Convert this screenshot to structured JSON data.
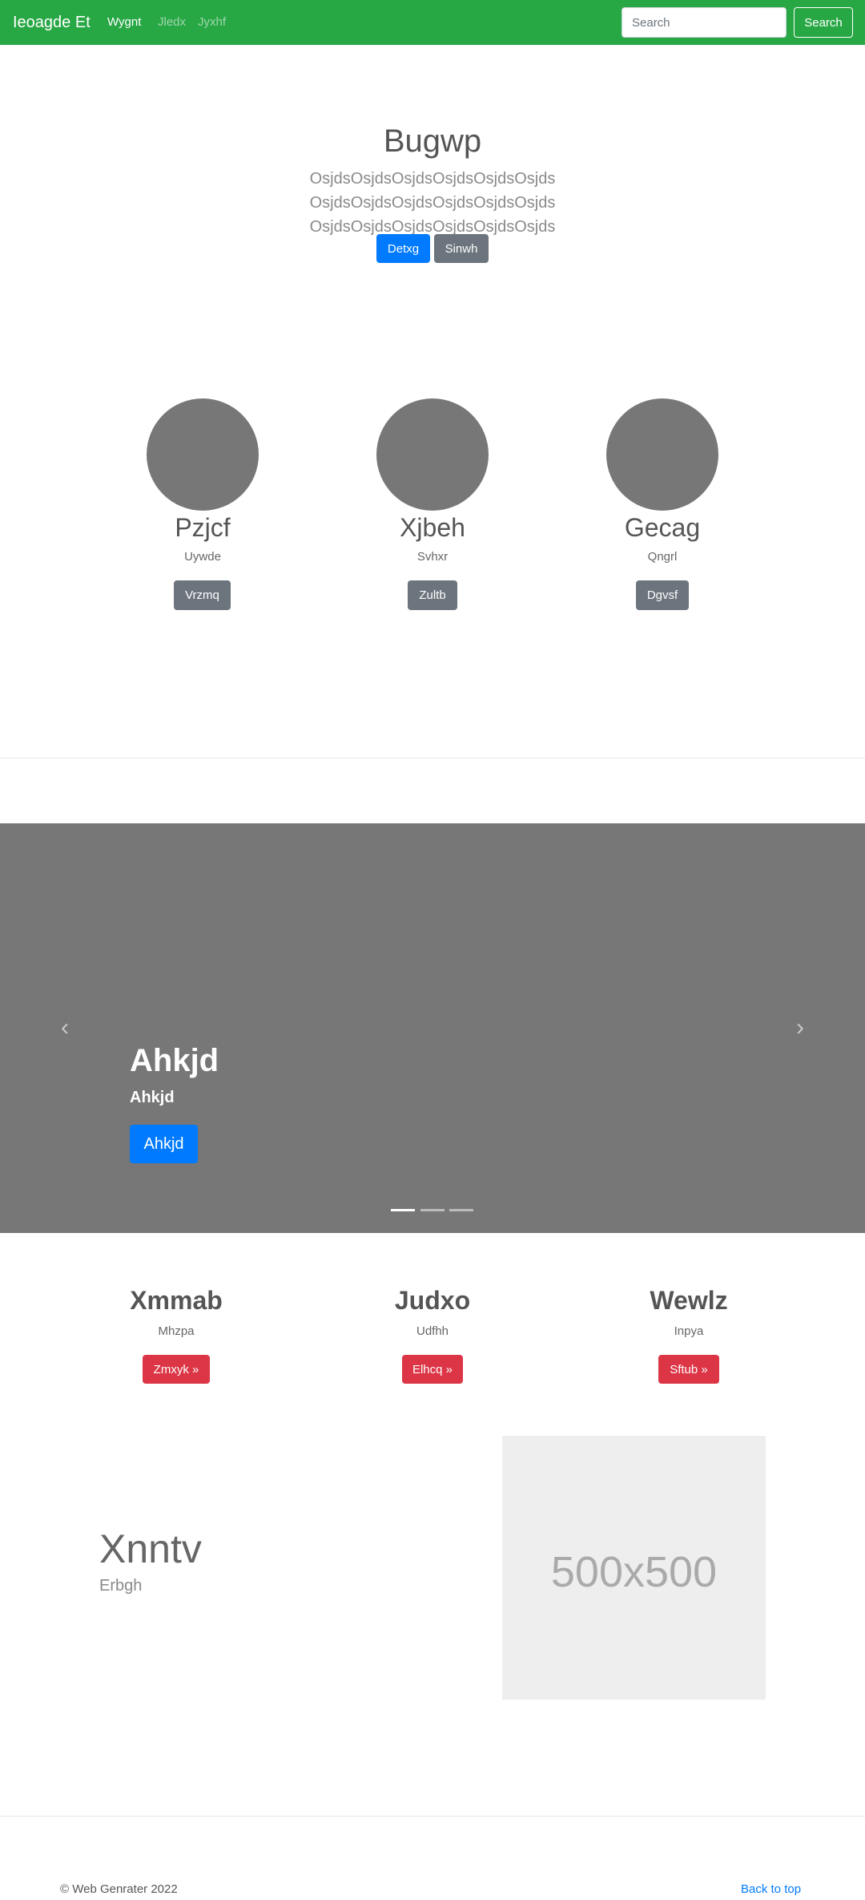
{
  "navbar": {
    "brand": "Ieoagde Et",
    "links": [
      "Wygnt",
      "Jledx",
      "Jyxhf"
    ],
    "search_placeholder": "Search",
    "search_button": "Search"
  },
  "hero": {
    "title": "Bugwp",
    "lead": "OsjdsOsjdsOsjdsOsjdsOsjdsOsjds OsjdsOsjdsOsjdsOsjdsOsjdsOsjds OsjdsOsjdsOsjdsOsjdsOsjdsOsjds",
    "primary_button": "Detxg",
    "secondary_button": "Sinwh"
  },
  "circles": [
    {
      "name": "Pzjcf",
      "subtitle": "Uywde",
      "button": "Vrzmq"
    },
    {
      "name": "Xjbeh",
      "subtitle": "Svhxr",
      "button": "Zultb"
    },
    {
      "name": "Gecag",
      "subtitle": "Qngrl",
      "button": "Dgvsf"
    }
  ],
  "carousel": {
    "title": "Ahkjd",
    "subtitle": "Ahkjd",
    "button": "Ahkjd",
    "prev_icon": "‹",
    "next_icon": "›",
    "active_slide": 1,
    "slide_count": 3
  },
  "features": [
    {
      "title": "Xmmab",
      "subtitle": "Mhzpa",
      "button": "Zmxyk »"
    },
    {
      "title": "Judxo",
      "subtitle": "Udfhh",
      "button": "Elhcq »"
    },
    {
      "title": "Wewlz",
      "subtitle": "Inpya",
      "button": "Sftub »"
    }
  ],
  "featurette": {
    "title": "Xnntv",
    "subtitle": "Erbgh",
    "image_label": "500x500"
  },
  "footer": {
    "copyright": "© Web Genrater 2022",
    "back_to_top": "Back to top"
  },
  "colors": {
    "navbar": "#28a745",
    "primary": "#007bff",
    "secondary": "#6c757d",
    "danger": "#dc3545",
    "carousel_bg": "#777777"
  }
}
